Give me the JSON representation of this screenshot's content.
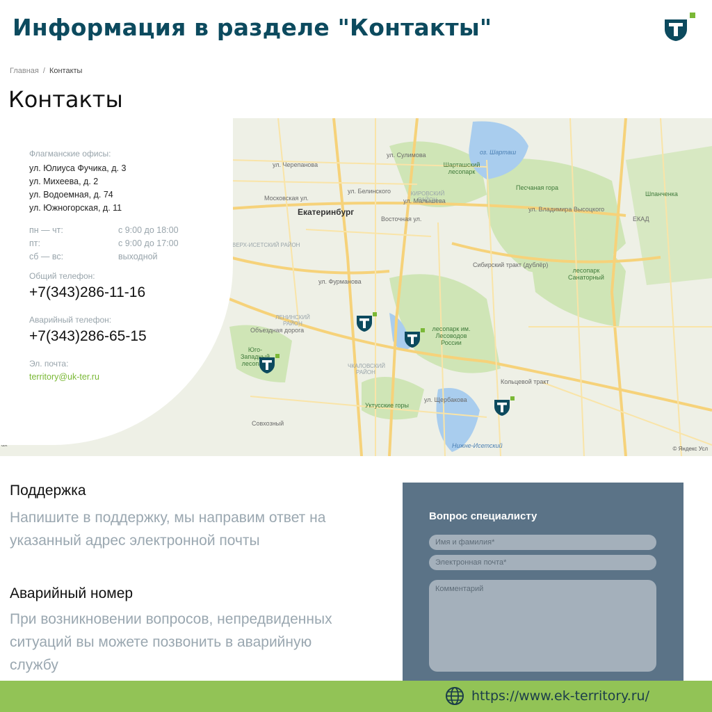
{
  "banner": {
    "title": "Информация в разделе \"Контакты\""
  },
  "breadcrumb": {
    "home": "Главная",
    "separator": "/",
    "current": "Контакты"
  },
  "page": {
    "title": "Контакты"
  },
  "contact_card": {
    "offices_label": "Флагманские офисы:",
    "offices": [
      "ул. Юлиуса Фучика, д. 3",
      "ул. Михеева, д. 2",
      "ул. Водоемная, д. 74",
      "ул. Южногорская, д. 11"
    ],
    "hours": [
      {
        "days": "пн — чт:",
        "time": "с 9:00 до 18:00"
      },
      {
        "days": "пт:",
        "time": "с 9:00 до 17:00"
      },
      {
        "days": "сб — вс:",
        "time": "выходной"
      }
    ],
    "general_phone_label": "Общий телефон:",
    "general_phone": "+7(343)286-11-16",
    "emergency_phone_label": "Аварийный телефон:",
    "emergency_phone": "+7(343)286-65-15",
    "email_label": "Эл. почта:",
    "email": "territory@uk-ter.ru"
  },
  "map": {
    "city": "Екатеринбург",
    "lake": "оз. Шарташ",
    "parks": [
      "Шарташский лесопарк",
      "Песчаная гора",
      "Шпанченка",
      "лесопарк Санаторный",
      "лесопарк им. Лесоводов России",
      "Юго-Западный лесопарк",
      "Уктусские горы"
    ],
    "districts": [
      "Кировский район",
      "Ленинский район",
      "Чкаловский район",
      "Верх-Исетский район"
    ],
    "streets": [
      "ул. Сулимова",
      "ул. Малышева",
      "ул. Владимира Высоцкого",
      "Сибирский тракт (дублёр)",
      "ул. Фурманова",
      "ул. Щербакова",
      "Объездная дорога",
      "ЕКАД",
      "Кольцевой тракт",
      "Московская ул.",
      "ул. Белинского",
      "Восточная ул.",
      "ул. Черепанова",
      "Совхозный",
      "Нижне-Исетский"
    ],
    "copyright": "© Яндекс Усл",
    "left_edge": "ах",
    "marker_icon": "company-marker-icon"
  },
  "support": {
    "title": "Поддержка",
    "text": "Напишите в поддержку, мы направим ответ на указанный адрес электронной почты"
  },
  "emergency": {
    "title": "Аварийный номер",
    "text": "При возникновении вопросов, непредвиденных ситуаций вы можете позвонить в аварийную службу"
  },
  "form": {
    "title": "Вопрос специалисту",
    "name_placeholder": "Имя и фамилия*",
    "email_placeholder": "Электронная почта*",
    "comment_placeholder": "Комментарий"
  },
  "footer": {
    "url": "https://www.ek-territory.ru/",
    "icon": "globe-icon"
  },
  "colors": {
    "brand_dark": "#0c4a5e",
    "accent_green": "#7ab836",
    "footer_green": "#92c356",
    "form_panel": "#5b7387"
  }
}
